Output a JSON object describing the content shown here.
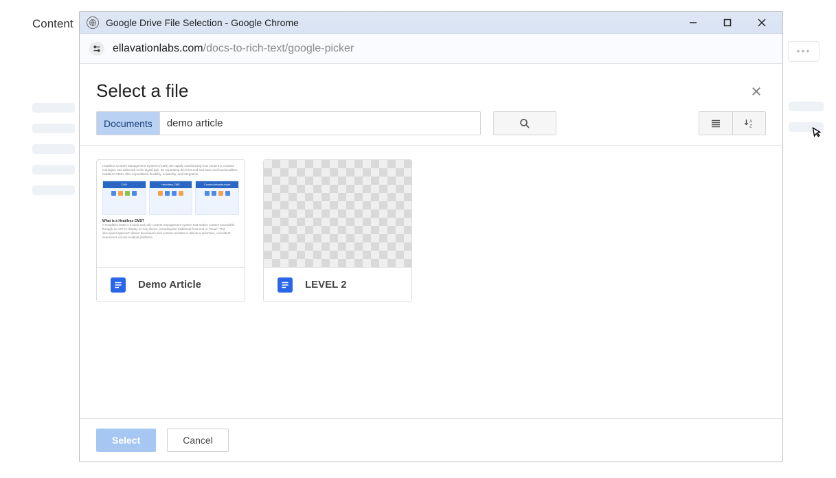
{
  "bg": {
    "content_label": "Content",
    "right_chip": "•••"
  },
  "window": {
    "title": "Google Drive File Selection - Google Chrome",
    "url_host": "ellavationlabs.com",
    "url_path": "/docs-to-rich-text/google-picker"
  },
  "picker": {
    "title": "Select a file",
    "search_chip": "Documents",
    "search_value": "demo article",
    "buttons": {
      "select": "Select",
      "cancel": "Cancel"
    }
  },
  "files": [
    {
      "name": "Demo Article"
    },
    {
      "name": "LEVEL 2"
    }
  ]
}
